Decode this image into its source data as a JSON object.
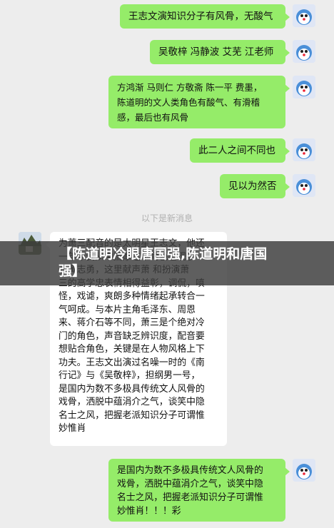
{
  "messages": [
    {
      "side": "right",
      "text": "王志文演知识分子有风骨，无酸气"
    },
    {
      "side": "right",
      "text": "吴敬梓 冯静波 艾芜 江老师"
    },
    {
      "side": "right",
      "text": "方鸿渐 马则仁 方敬斋 陈一平 费墨，\n陈道明的文人类角色有酸气、有滑稽\n感，最后也有风骨"
    },
    {
      "side": "right",
      "text": "此二人之间不同也"
    },
    {
      "side": "right",
      "text": "见以为然否"
    },
    {
      "side": "left",
      "text": "为萧三配音的是太明星王志文，他还\n一年年我从中揣摩这个角色也现参\n长黄志勇，这里献声萧 和扮演萧\n三的高学忠表情相得益彰，调侃，嗔\n怪，戏谑，爽朗多种情绪起承转合一\n气呵成。与本片主角毛泽东、周恩\n来、蒋介石等不同，萧三是个绝对冷\n门的角色，声音缺乏辨识度，配音要\n想贴合角色，关键是在人物风格上下\n功夫。王志文出演过名噪一时的《南\n行记》与《吴敬梓》，担纲男一号，\n是国内为数不多极具传统文人风骨的\n戏骨，洒脱中蕴涓介之气，谈笑中隐\n名士之风，把握老派知识分子可谓惟\n妙惟肖"
    },
    {
      "side": "right",
      "text": "是国内为数不多极具传统文人风骨的\n戏骨，洒脱中蕴涓介之气，谈笑中隐\n名士之风，把握老派知识分子可谓惟\n妙惟肖！！！彩"
    }
  ],
  "divider": "以下是新消息",
  "overlay": {
    "title": "【陈道明冷眼唐国强,陈道明和唐国强】"
  },
  "colors": {
    "bg": "#ededed",
    "right_bubble": "#95ec69",
    "left_bubble": "#ffffff"
  }
}
